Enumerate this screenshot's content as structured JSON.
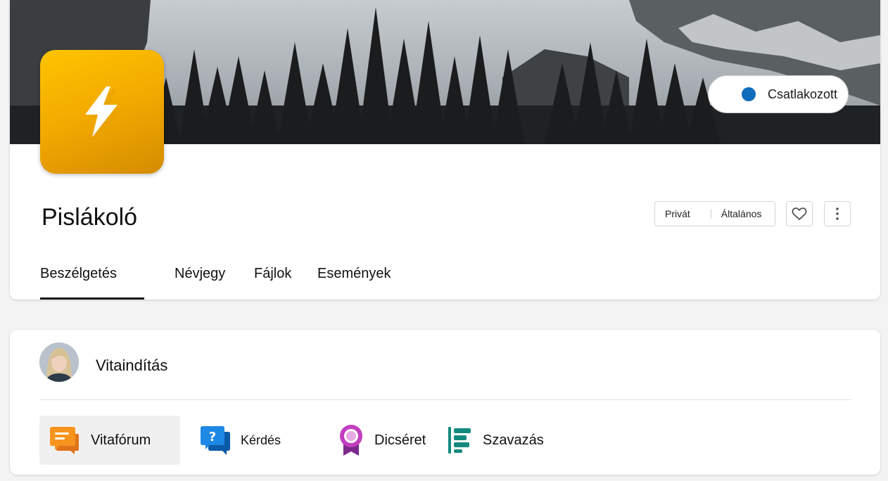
{
  "header": {
    "join_label": "Csatlakozott",
    "community_name": "Pislákoló",
    "tags": [
      "Privát",
      "Általános"
    ]
  },
  "tabs": [
    {
      "label": "Beszélgetés",
      "active": true
    },
    {
      "label": "Névjegy"
    },
    {
      "label": "Fájlok"
    },
    {
      "label": "Események"
    }
  ],
  "composer": {
    "prompt": "Vitaindítás",
    "actions": [
      {
        "label": "Vitafórum",
        "icon": "discussion-icon",
        "active": true
      },
      {
        "label": "Kérdés",
        "icon": "question-icon"
      },
      {
        "label": "Dicséret",
        "icon": "praise-icon"
      },
      {
        "label": "Szavazás",
        "icon": "poll-icon"
      }
    ]
  },
  "colors": {
    "accent": "#0f6cbd",
    "logo": "#f2a900",
    "discussion": "#f7941d",
    "question": "#1e88e5",
    "praise": "#b83ab8",
    "poll": "#138a7e"
  }
}
